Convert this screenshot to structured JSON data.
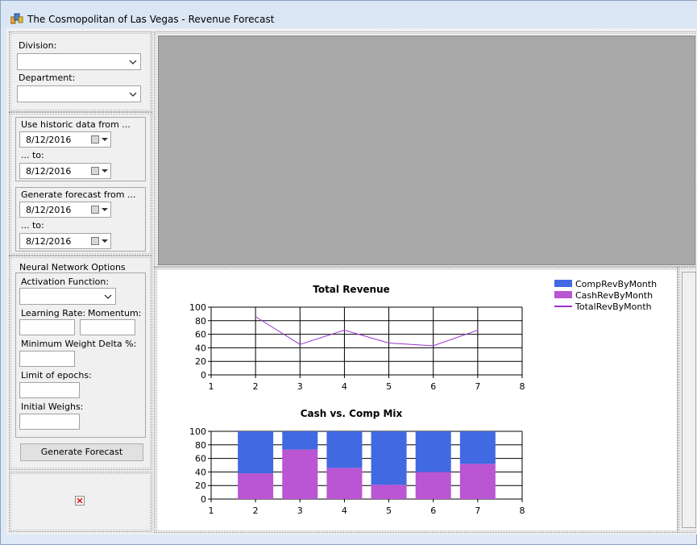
{
  "window": {
    "title": "The Cosmopolitan of Las Vegas - Revenue Forecast"
  },
  "filters": {
    "division_label": "Division:",
    "division_value": "",
    "department_label": "Department:",
    "department_value": ""
  },
  "historic": {
    "title": "Use historic data from ...",
    "from_value": "8/12/2016",
    "to_label": "... to:",
    "to_value": "8/12/2016"
  },
  "forecast": {
    "title": "Generate forecast from ...",
    "from_value": "8/12/2016",
    "to_label": "... to:",
    "to_value": "8/12/2016"
  },
  "nn": {
    "title": "Neural Network Options",
    "activation_label": "Activation Function:",
    "activation_value": "",
    "learning_rate_label": "Learning Rate:",
    "learning_rate_value": "",
    "momentum_label": "Momentum:",
    "momentum_value": "",
    "min_weight_label": "Minimum Weight Delta %:",
    "min_weight_value": "",
    "epochs_label": "Limit of epochs:",
    "epochs_value": "",
    "initial_weights_label": "Initial Weighs:",
    "initial_weights_value": "",
    "generate_button": "Generate Forecast"
  },
  "colors": {
    "comp": "#4169e1",
    "cash": "#ba55d3",
    "total": "#9932cc"
  },
  "legend": [
    "CompRevByMonth",
    "CashRevByMonth",
    "TotalRevByMonth"
  ],
  "chart_data": [
    {
      "type": "line",
      "title": "Total Revenue",
      "x": [
        2,
        3,
        4,
        5,
        6,
        7
      ],
      "series": [
        {
          "name": "TotalRevByMonth",
          "values": [
            86,
            45,
            66,
            47,
            43,
            66
          ]
        }
      ],
      "xlim": [
        1,
        8
      ],
      "ylim": [
        0,
        100
      ],
      "xticks": [
        "1",
        "2",
        "3",
        "4",
        "5",
        "6",
        "7",
        "8"
      ],
      "yticks": [
        "0",
        "20",
        "40",
        "60",
        "80",
        "100"
      ],
      "grid": true
    },
    {
      "type": "bar",
      "title": "Cash vs. Comp Mix",
      "x": [
        2,
        3,
        4,
        5,
        6,
        7
      ],
      "series": [
        {
          "name": "CashRevByMonth",
          "values": [
            38,
            73,
            46,
            21,
            40,
            52
          ]
        },
        {
          "name": "CompRevByMonth",
          "values": [
            62,
            27,
            54,
            79,
            60,
            48
          ]
        }
      ],
      "stacked": true,
      "xlim": [
        1,
        8
      ],
      "ylim": [
        0,
        100
      ],
      "xticks": [
        "1",
        "2",
        "3",
        "4",
        "5",
        "6",
        "7",
        "8"
      ],
      "yticks": [
        "0",
        "20",
        "40",
        "60",
        "80",
        "100"
      ],
      "grid": true
    }
  ]
}
